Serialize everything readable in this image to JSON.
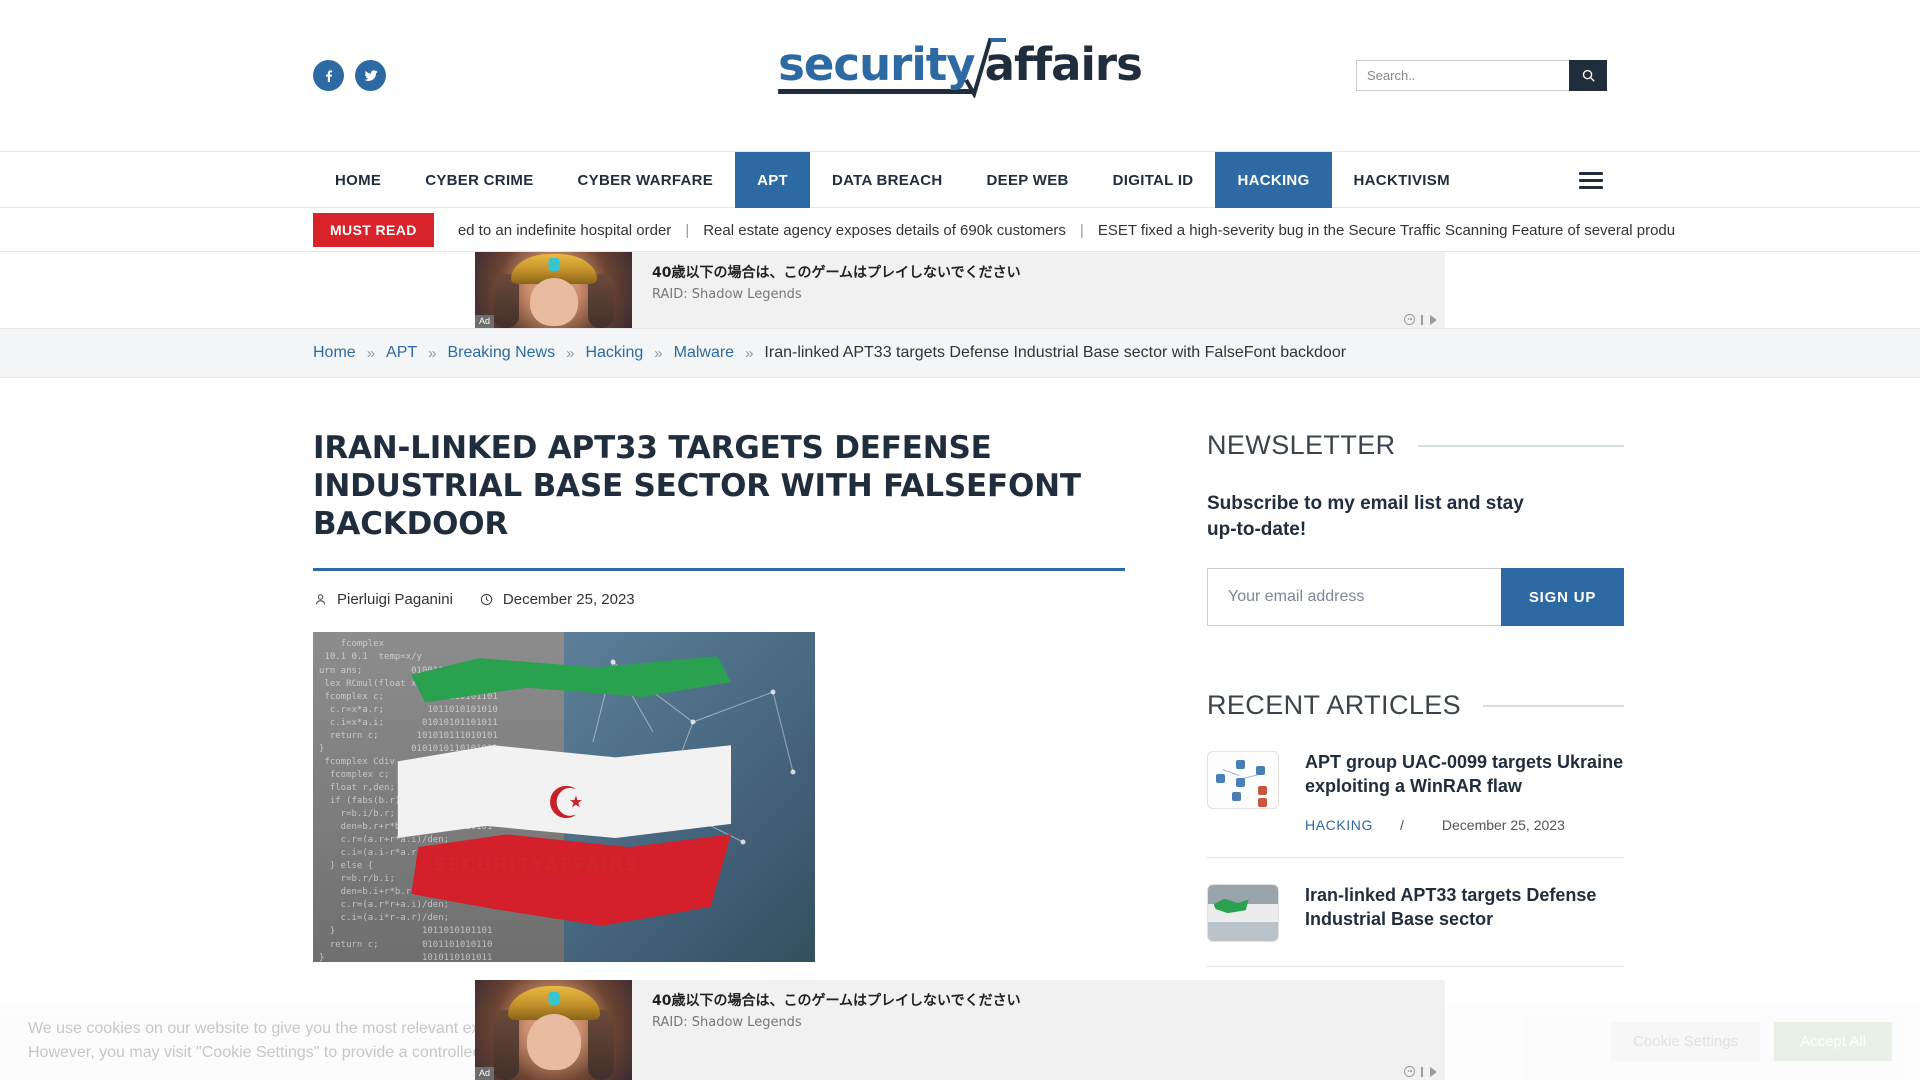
{
  "header": {
    "logo": {
      "part1": "security",
      "part2": "affairs",
      "radical": "radical-sign"
    },
    "social": [
      {
        "name": "facebook",
        "label": "Facebook"
      },
      {
        "name": "twitter",
        "label": "Twitter"
      }
    ],
    "search": {
      "placeholder": "Search..",
      "value": "",
      "button_icon": "search-icon"
    }
  },
  "nav": {
    "items": [
      {
        "label": "HOME",
        "active": false
      },
      {
        "label": "CYBER CRIME",
        "active": false
      },
      {
        "label": "CYBER WARFARE",
        "active": false
      },
      {
        "label": "APT",
        "active": true
      },
      {
        "label": "DATA BREACH",
        "active": false
      },
      {
        "label": "DEEP WEB",
        "active": false
      },
      {
        "label": "DIGITAL ID",
        "active": false
      },
      {
        "label": "HACKING",
        "active": true
      },
      {
        "label": "HACKTIVISM",
        "active": false
      }
    ],
    "menu_icon": "hamburger-menu-icon"
  },
  "ticker": {
    "badge": "MUST READ",
    "items": [
      "ed to an indefinite hospital order",
      "Real estate agency exposes details of 690k customers",
      "ESET fixed a high-severity bug in the Secure Traffic Scanning Feature of several produ"
    ],
    "separator": "|"
  },
  "ad_top": {
    "title": "40歳以下の場合は、このゲームはプレイしないでください",
    "subtitle": "RAID: Shadow Legends",
    "badge": "Ad"
  },
  "ad_bottom": {
    "title": "40歳以下の場合は、このゲームはプレイしないでください",
    "subtitle": "RAID: Shadow Legends",
    "badge": "Ad",
    "close_label": "✕"
  },
  "breadcrumb": {
    "separator": "»",
    "items": [
      {
        "label": "Home",
        "link": true
      },
      {
        "label": "APT",
        "link": true
      },
      {
        "label": "Breaking News",
        "link": true
      },
      {
        "label": "Hacking",
        "link": true
      },
      {
        "label": "Malware",
        "link": true
      },
      {
        "label": "Iran-linked APT33 targets Defense Industrial Base sector with FalseFont backdoor",
        "link": false
      }
    ]
  },
  "post": {
    "title": "Iran-linked APT33 targets Defense Industrial Base sector with FalseFont backdoor",
    "author": "Pierluigi Paganini",
    "author_icon": "user-icon",
    "date": "December 25, 2023",
    "date_icon": "clock-icon",
    "image_caption": "Iran flag over binary code background"
  },
  "sidebar": {
    "newsletter": {
      "heading": "NEWSLETTER",
      "subtitle": "Subscribe to my email list and stay up-to-date!",
      "placeholder": "Your email address",
      "value": "",
      "button": "SIGN UP"
    },
    "recent": {
      "heading": "RECENT ARTICLES",
      "articles": [
        {
          "title": "APT group UAC-0099 targets Ukraine exploiting a WinRAR flaw",
          "category": "HACKING",
          "separator": "/",
          "date": "December 25, 2023",
          "thumb": "network-diagram-thumbnail"
        },
        {
          "title": "Iran-linked APT33 targets Defense Industrial Base sector",
          "category": "",
          "separator": "",
          "date": "",
          "thumb": "iran-flag-thumbnail"
        }
      ]
    }
  },
  "cookie": {
    "text_line1": "We use cookies on our website to give you the most relevant experience by remembering your preferences and repeat visits. By clicking “Accept All”, you consent to the use of ALL the cookies.",
    "text_line2": "However, you may visit \"Cookie Settings\" to provide a controlled consent.",
    "settings_button": "Cookie Settings",
    "accept_button": "Accept All",
    "close_label": "✕"
  },
  "colors": {
    "brand_blue": "#2d6aa3",
    "dark_navy": "#1f2d3d",
    "must_read_red": "#d8232a",
    "accept_green": "#d7e8cf"
  }
}
